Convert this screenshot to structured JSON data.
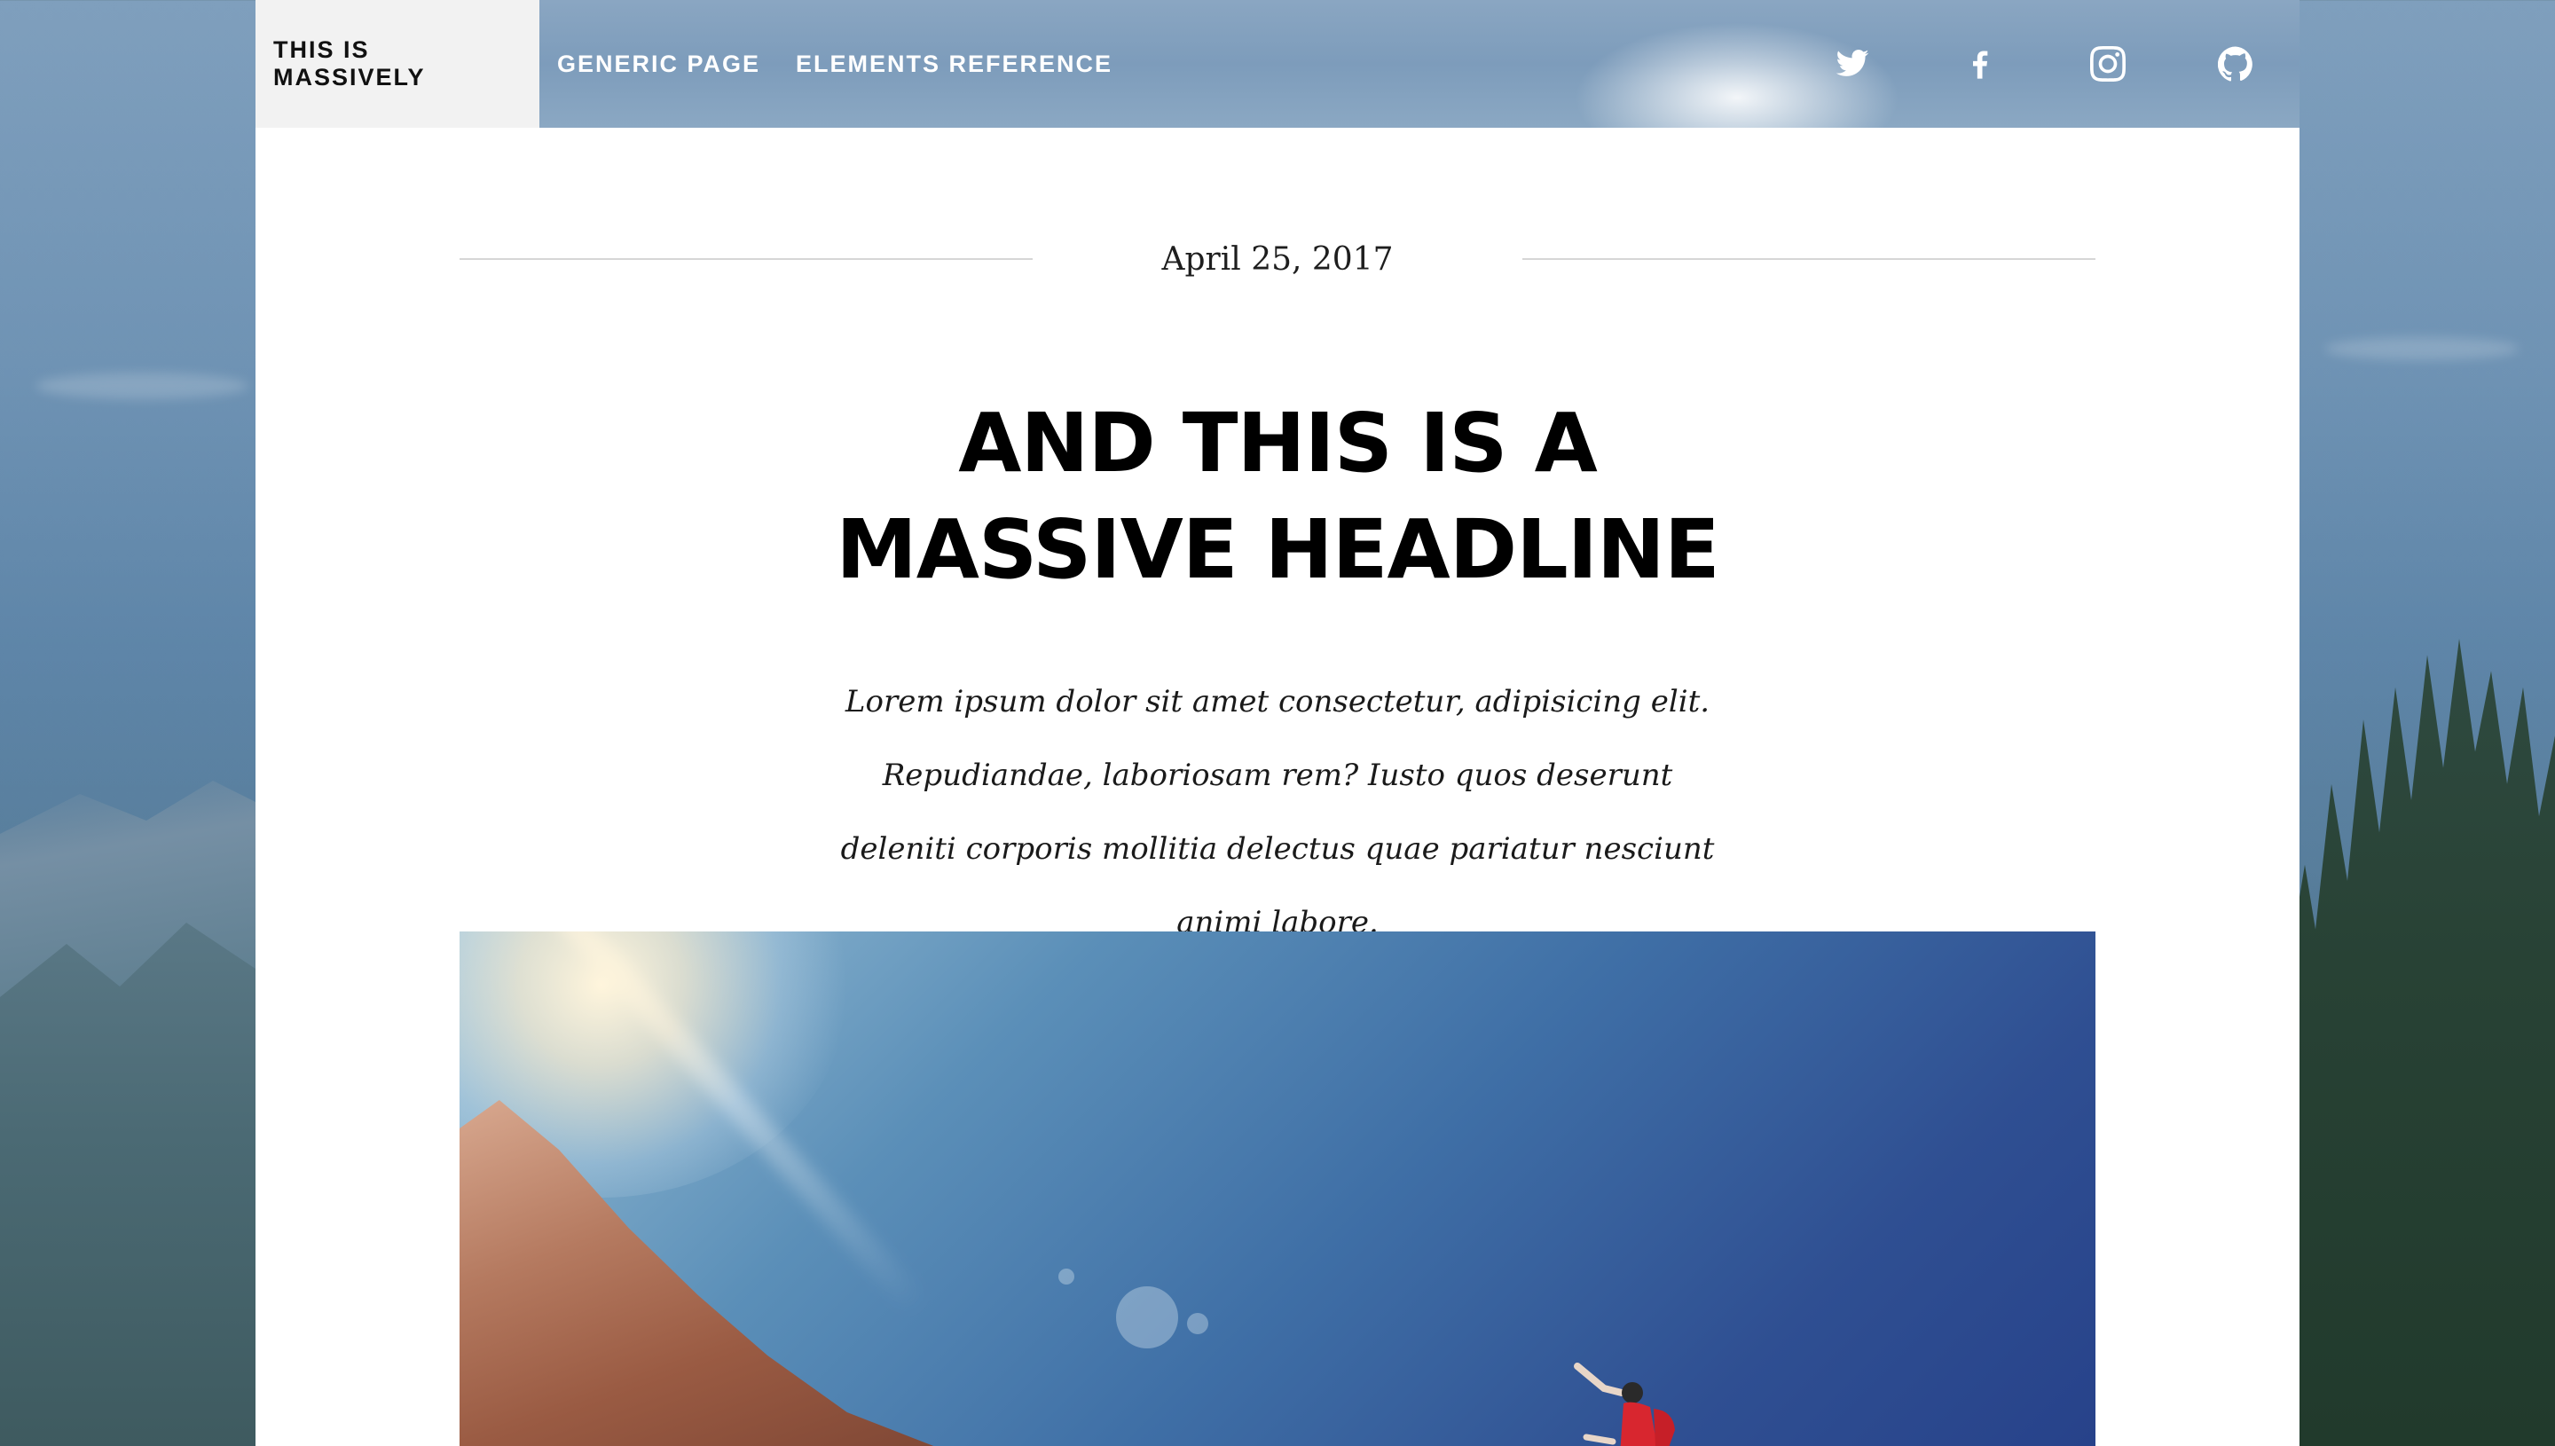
{
  "nav": {
    "links": [
      {
        "label": "This is Massively",
        "active": true
      },
      {
        "label": "Generic Page",
        "active": false
      },
      {
        "label": "Elements Reference",
        "active": false
      }
    ],
    "icons": [
      "twitter-icon",
      "facebook-icon",
      "instagram-icon",
      "github-icon"
    ]
  },
  "post": {
    "date": "April 25, 2017",
    "headline_line1": "And this is a",
    "headline_line2": "massive headline",
    "intro": "Lorem ipsum dolor sit amet consectetur, adipisicing elit. Repudiandae, laboriosam rem? Iusto quos deserunt deleniti corporis mollitia delectus quae pariatur nesciunt animi labore."
  },
  "colors": {
    "nav_active_bg": "#f2f2f2",
    "page_bg": "#ffffff",
    "text": "#000000",
    "rule": "#d6d6d6"
  }
}
